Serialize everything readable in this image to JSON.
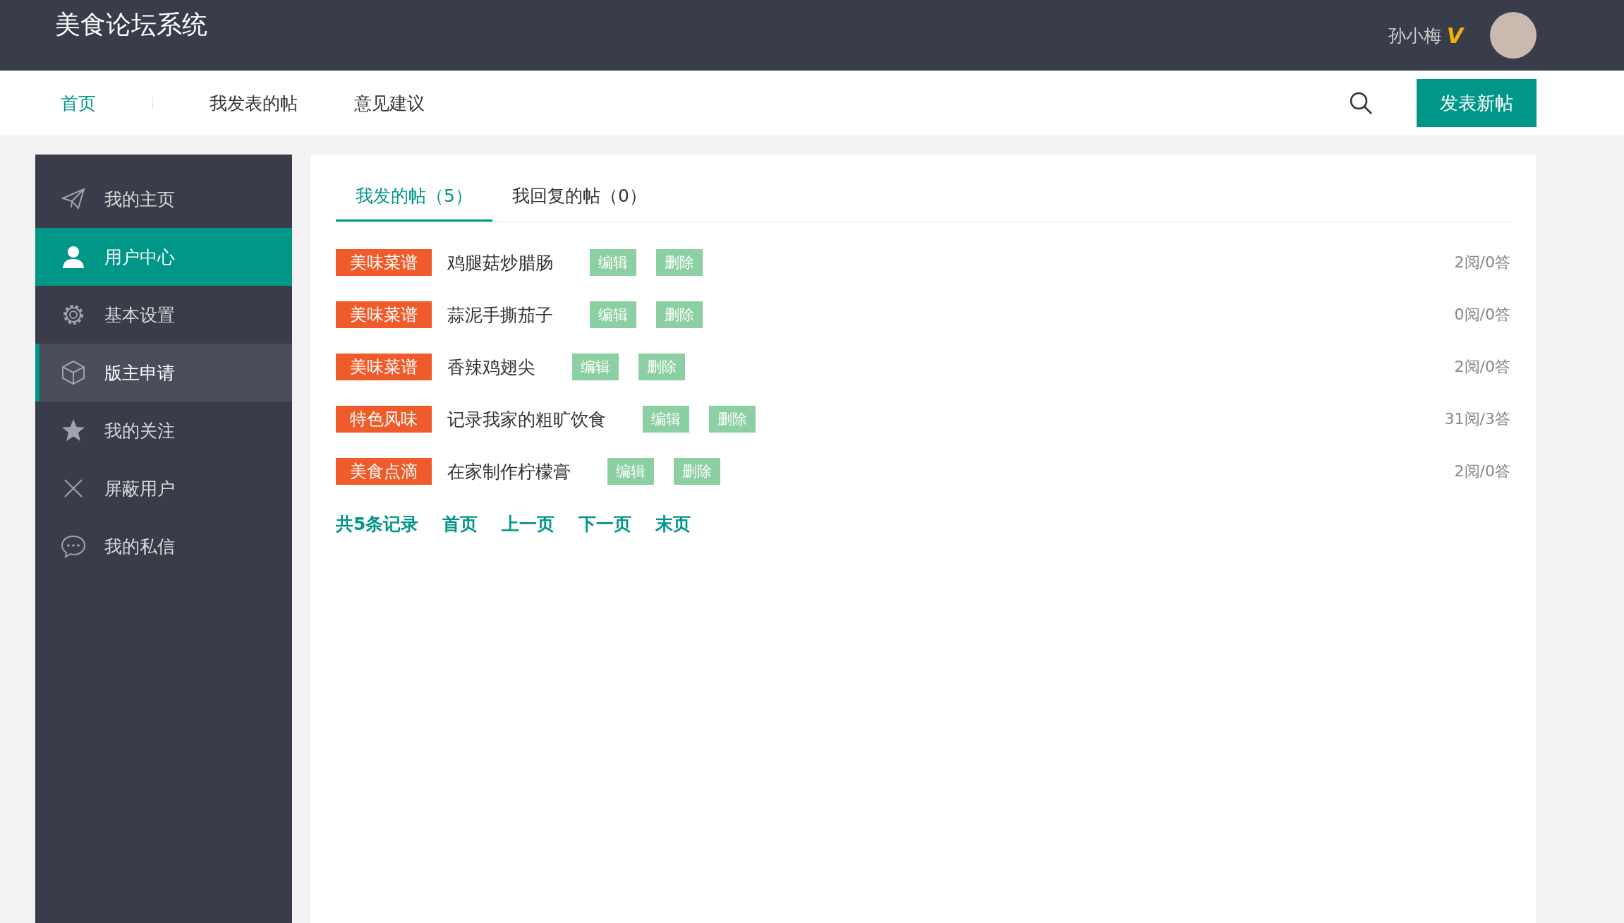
{
  "header": {
    "title": "美食论坛系统",
    "username": "孙小梅",
    "vip_badge": "V"
  },
  "nav": {
    "items": [
      {
        "label": "首页",
        "selected": true
      },
      {
        "label": "我发表的帖",
        "selected": false
      },
      {
        "label": "意见建议",
        "selected": false
      }
    ],
    "new_post_button": "发表新帖"
  },
  "sidebar": {
    "items": [
      {
        "label": "我的主页",
        "kind": "send",
        "selected": false,
        "highlighted": false
      },
      {
        "label": "用户中心",
        "kind": "user",
        "selected": true,
        "highlighted": false
      },
      {
        "label": "基本设置",
        "kind": "gear",
        "selected": false,
        "highlighted": false
      },
      {
        "label": "版主申请",
        "kind": "cube",
        "selected": false,
        "highlighted": true
      },
      {
        "label": "我的关注",
        "kind": "star",
        "selected": false,
        "highlighted": false
      },
      {
        "label": "屏蔽用户",
        "kind": "x",
        "selected": false,
        "highlighted": false
      },
      {
        "label": "我的私信",
        "kind": "chat",
        "selected": false,
        "highlighted": false
      }
    ]
  },
  "tabs": [
    {
      "label": "我发的帖（5）",
      "selected": true
    },
    {
      "label": "我回复的帖（0）",
      "selected": false
    }
  ],
  "posts": [
    {
      "category": "美味菜谱",
      "title": "鸡腿菇炒腊肠",
      "edit": "编辑",
      "delete": "删除",
      "stats": "2阅/0答"
    },
    {
      "category": "美味菜谱",
      "title": "蒜泥手撕茄子",
      "edit": "编辑",
      "delete": "删除",
      "stats": "0阅/0答"
    },
    {
      "category": "美味菜谱",
      "title": "香辣鸡翅尖",
      "edit": "编辑",
      "delete": "删除",
      "stats": "2阅/0答"
    },
    {
      "category": "特色风味",
      "title": "记录我家的粗旷饮食",
      "edit": "编辑",
      "delete": "删除",
      "stats": "31阅/3答"
    },
    {
      "category": "美食点滴",
      "title": "在家制作柠檬膏",
      "edit": "编辑",
      "delete": "删除",
      "stats": "2阅/0答"
    }
  ],
  "pagination": {
    "total": "共5条记录",
    "links": [
      "首页",
      "上一页",
      "下一页",
      "末页"
    ]
  }
}
